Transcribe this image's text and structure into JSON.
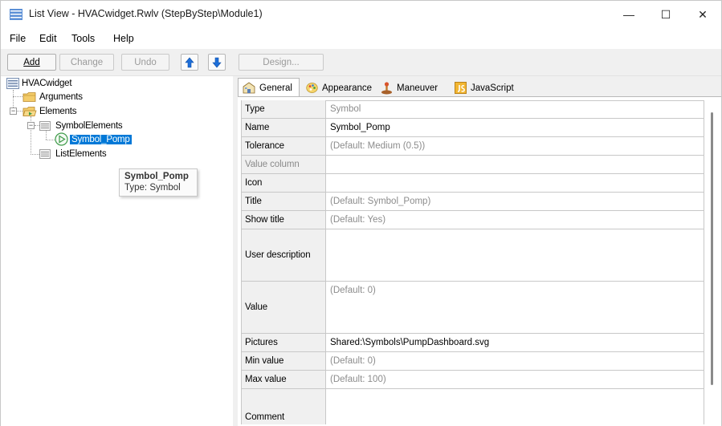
{
  "window": {
    "title": "List View - HVACwidget.Rwlv (StepByStep\\Module1)",
    "controls": {
      "minimize": "—",
      "maximize": "☐",
      "close": "✕"
    }
  },
  "menu": {
    "items": [
      "File",
      "Edit",
      "Tools",
      "Help"
    ]
  },
  "toolbar": {
    "add": "Add",
    "change": "Change",
    "undo": "Undo",
    "design": "Design...",
    "up_icon": "arrow-up-icon",
    "down_icon": "arrow-down-icon"
  },
  "tree": {
    "root": "HVACwidget",
    "arguments": "Arguments",
    "elements": "Elements",
    "symbol_elements": "SymbolElements",
    "symbol_pomp": "Symbol_Pomp",
    "list_elements": "ListElements"
  },
  "tooltip": {
    "title": "Symbol_Pomp",
    "subtitle": "Type: Symbol"
  },
  "tabs": [
    "General",
    "Appearance",
    "Maneuver",
    "JavaScript"
  ],
  "properties": [
    {
      "name": "Type",
      "value": "Symbol",
      "value_style": "gray"
    },
    {
      "name": "Name",
      "value": "Symbol_Pomp",
      "value_style": "normal"
    },
    {
      "name": "Tolerance",
      "value": "(Default: Medium (0.5))",
      "value_style": "gray"
    },
    {
      "name": "Value column",
      "value": "",
      "value_style": "normal",
      "name_style": "dim"
    },
    {
      "name": "Icon",
      "value": "",
      "value_style": "normal"
    },
    {
      "name": "Title",
      "value": "(Default: Symbol_Pomp)",
      "value_style": "gray"
    },
    {
      "name": "Show title",
      "value": "(Default: Yes)",
      "value_style": "gray"
    },
    {
      "name": "User description",
      "value": "",
      "value_style": "normal"
    },
    {
      "name": "Value",
      "value": "(Default: 0)",
      "value_style": "gray"
    },
    {
      "name": "Pictures",
      "value": "Shared:\\Symbols\\PumpDashboard.svg",
      "value_style": "normal"
    },
    {
      "name": "Min value",
      "value": "(Default: 0)",
      "value_style": "gray"
    },
    {
      "name": "Max value",
      "value": "(Default: 100)",
      "value_style": "gray"
    },
    {
      "name": "Comment",
      "value": "",
      "value_style": "normal"
    }
  ],
  "colors": {
    "selection": "#0078d7",
    "arrow_blue": "#1e6fd9",
    "folder": "#e8b84a"
  }
}
